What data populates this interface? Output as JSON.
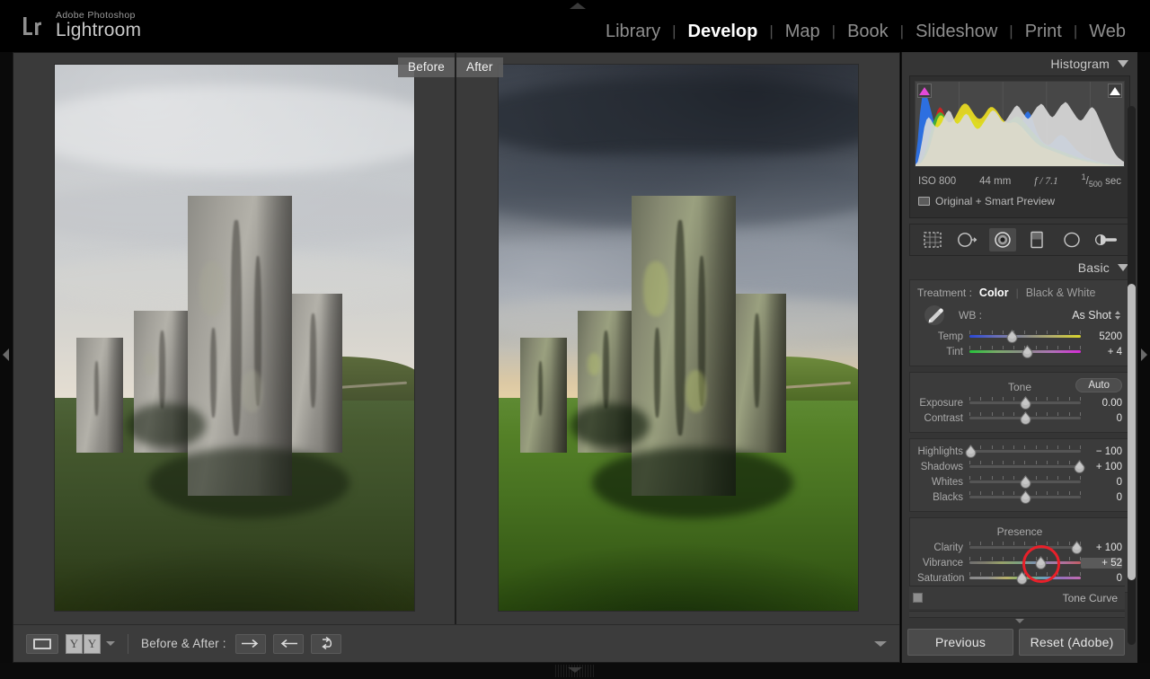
{
  "app": {
    "brand_small": "Adobe Photoshop",
    "brand_big": "Lightroom",
    "logo_text": "Lr"
  },
  "modules": [
    {
      "label": "Library",
      "active": false
    },
    {
      "label": "Develop",
      "active": true
    },
    {
      "label": "Map",
      "active": false
    },
    {
      "label": "Book",
      "active": false
    },
    {
      "label": "Slideshow",
      "active": false
    },
    {
      "label": "Print",
      "active": false
    },
    {
      "label": "Web",
      "active": false
    }
  ],
  "module_separator": "|",
  "view": {
    "before_label": "Before",
    "after_label": "After"
  },
  "toolbar": {
    "view_mode_icon": "loupe-view-icon",
    "compare_icon_left": "Y",
    "compare_icon_right": "Y",
    "caret_icon": "chevron-down-icon",
    "before_after_label": "Before & After :",
    "copy_settings_right_icon": "arrow-right-icon",
    "copy_settings_left_icon": "arrow-left-icon",
    "swap_settings_icon": "swap-arrows-icon"
  },
  "histogram": {
    "title": "Histogram",
    "collapse_icon": "chevron-down-icon",
    "shadow_clip_icon": "shadow-clipping-triangle",
    "highlight_clip_icon": "highlight-clipping-triangle",
    "exif": {
      "iso": "ISO 800",
      "focal_length": "44 mm",
      "aperture": "f / 7.1",
      "shutter_numerator": "1",
      "shutter_denominator": "500",
      "shutter_unit": "sec"
    },
    "preview_state": "Original + Smart Preview",
    "preview_state_icon": "smart-preview-icon"
  },
  "tools": [
    {
      "name": "crop-overlay-icon",
      "active": false
    },
    {
      "name": "spot-removal-icon",
      "active": false
    },
    {
      "name": "red-eye-correction-icon",
      "active": true
    },
    {
      "name": "graduated-filter-icon",
      "active": false
    },
    {
      "name": "radial-filter-icon",
      "active": false
    },
    {
      "name": "adjustment-brush-icon",
      "active": false
    }
  ],
  "basic": {
    "title": "Basic",
    "collapse_icon": "chevron-down-icon",
    "treatment_label": "Treatment :",
    "treatment_options": [
      {
        "label": "Color",
        "selected": true
      },
      {
        "label": "Black & White",
        "selected": false
      }
    ],
    "treatment_separator": "|",
    "wb_label": "WB :",
    "wb_value": "As Shot",
    "eyedropper_icon": "white-balance-eyedropper-icon",
    "white_balance_sliders": [
      {
        "label": "Temp",
        "value": "5200",
        "pos": 38,
        "track": "temp"
      },
      {
        "label": "Tint",
        "value": "+ 4",
        "pos": 52,
        "track": "tint"
      }
    ],
    "tone_title": "Tone",
    "auto_label": "Auto",
    "tone_sliders": [
      {
        "label": "Exposure",
        "value": "0.00",
        "pos": 50,
        "track": "plain"
      },
      {
        "label": "Contrast",
        "value": "0",
        "pos": 50,
        "track": "plain"
      }
    ],
    "tone_sliders2": [
      {
        "label": "Highlights",
        "value": "− 100",
        "pos": 1,
        "track": "plain"
      },
      {
        "label": "Shadows",
        "value": "+ 100",
        "pos": 99,
        "track": "plain"
      },
      {
        "label": "Whites",
        "value": "0",
        "pos": 50,
        "track": "plain"
      },
      {
        "label": "Blacks",
        "value": "0",
        "pos": 50,
        "track": "plain"
      }
    ],
    "presence_title": "Presence",
    "presence_sliders": [
      {
        "label": "Clarity",
        "value": "+ 100",
        "pos": 96,
        "track": "plain",
        "highlighted": false
      },
      {
        "label": "Vibrance",
        "value": "+ 52",
        "pos": 64,
        "track": "vib",
        "highlighted": true
      },
      {
        "label": "Saturation",
        "value": "0",
        "pos": 47,
        "track": "satur",
        "highlighted": false
      }
    ]
  },
  "tone_curve": {
    "title": "Tone Curve",
    "collapse_icon": "chevron-left-icon",
    "toggle_icon": "panel-toggle-switch"
  },
  "panel_buttons": {
    "previous": "Previous",
    "reset": "Reset (Adobe)"
  },
  "colors": {
    "accent_red": "#e8202a",
    "panel_bg": "#353535",
    "top_bg": "#000000",
    "stage_bg": "#3a3a3a",
    "text_primary": "#e3e3e3",
    "text_secondary": "#a9a9a9"
  },
  "histogram_series": {
    "gray": [
      2,
      5,
      16,
      30,
      46,
      55,
      58,
      55,
      50,
      47,
      46,
      48,
      52,
      58,
      63,
      66,
      64,
      58,
      52,
      50,
      52,
      56,
      60,
      62,
      60,
      55,
      50,
      46,
      44,
      45,
      48,
      52,
      56,
      60,
      64,
      66,
      65,
      62,
      58,
      54,
      52,
      54,
      58,
      62,
      66,
      70,
      72,
      70,
      66,
      62,
      58,
      56,
      58,
      62,
      66,
      70,
      72,
      74,
      72,
      68,
      64,
      60,
      58,
      60,
      64,
      68,
      72,
      74,
      76,
      74,
      70,
      66,
      62,
      58,
      55,
      54,
      56,
      60,
      64,
      68,
      70,
      68,
      64,
      58,
      52,
      46,
      40,
      34,
      28,
      22,
      17,
      13,
      10,
      8,
      6,
      5,
      4,
      3,
      2,
      1
    ],
    "blue": [
      8,
      30,
      62,
      82,
      88,
      84,
      76,
      66,
      56,
      46,
      37,
      30,
      24,
      19,
      15,
      12,
      10,
      8,
      7,
      6,
      6,
      5,
      5,
      4,
      4,
      4,
      4,
      4,
      4,
      5,
      5,
      6,
      6,
      7,
      7,
      8,
      8,
      9,
      9,
      10,
      11,
      12,
      14,
      17,
      21,
      26,
      33,
      41,
      50,
      58,
      63,
      65,
      62,
      56,
      48,
      41,
      35,
      31,
      28,
      26,
      25,
      26,
      28,
      31,
      34,
      36,
      37,
      36,
      34,
      31,
      28,
      25,
      22,
      19,
      17,
      15,
      13,
      11,
      10,
      9,
      8,
      7,
      6,
      5,
      4,
      4,
      3,
      3,
      2,
      2,
      2,
      1,
      1,
      1,
      1,
      1,
      0,
      0,
      0,
      0
    ],
    "green": [
      1,
      2,
      4,
      8,
      14,
      22,
      32,
      42,
      52,
      58,
      62,
      64,
      63,
      60,
      56,
      52,
      50,
      50,
      52,
      55,
      58,
      60,
      62,
      63,
      62,
      60,
      57,
      54,
      52,
      51,
      52,
      54,
      57,
      60,
      62,
      63,
      62,
      60,
      57,
      54,
      52,
      51,
      52,
      54,
      56,
      58,
      59,
      58,
      56,
      53,
      50,
      47,
      44,
      41,
      38,
      35,
      32,
      29,
      27,
      25,
      24,
      23,
      22,
      21,
      20,
      19,
      18,
      17,
      16,
      15,
      14,
      13,
      12,
      11,
      10,
      9,
      9,
      8,
      7,
      7,
      6,
      6,
      5,
      5,
      4,
      4,
      3,
      3,
      2,
      2,
      2,
      1,
      1,
      1,
      1,
      0,
      0,
      0,
      0,
      0
    ],
    "red": [
      1,
      2,
      3,
      6,
      10,
      16,
      24,
      34,
      46,
      58,
      66,
      70,
      68,
      62,
      55,
      50,
      48,
      48,
      50,
      52,
      54,
      55,
      55,
      54,
      52,
      50,
      48,
      46,
      45,
      45,
      46,
      48,
      50,
      52,
      53,
      53,
      52,
      50,
      48,
      46,
      45,
      44,
      44,
      45,
      46,
      46,
      45,
      44,
      42,
      40,
      38,
      36,
      34,
      32,
      30,
      28,
      26,
      24,
      23,
      22,
      21,
      20,
      19,
      18,
      17,
      16,
      15,
      14,
      13,
      12,
      11,
      10,
      9,
      9,
      8,
      7,
      7,
      6,
      6,
      5,
      5,
      4,
      4,
      3,
      3,
      3,
      2,
      2,
      2,
      1,
      1,
      1,
      1,
      1,
      0,
      0,
      0,
      0,
      0,
      0
    ],
    "yellow": [
      1,
      2,
      3,
      5,
      9,
      14,
      20,
      28,
      38,
      48,
      56,
      60,
      60,
      57,
      54,
      52,
      52,
      54,
      58,
      63,
      68,
      72,
      74,
      74,
      72,
      68,
      64,
      60,
      57,
      56,
      57,
      60,
      64,
      68,
      70,
      70,
      68,
      65,
      61,
      57,
      54,
      52,
      51,
      51,
      52,
      52,
      51,
      49,
      47,
      44,
      41,
      38,
      35,
      32,
      29,
      27,
      25,
      23,
      22,
      21,
      20,
      19,
      18,
      17,
      16,
      15,
      14,
      13,
      12,
      11,
      10,
      10,
      9,
      8,
      8,
      7,
      6,
      6,
      5,
      5,
      4,
      4,
      3,
      3,
      3,
      2,
      2,
      2,
      1,
      1,
      1,
      1,
      1,
      0,
      0,
      0,
      0,
      0,
      0,
      0
    ]
  }
}
